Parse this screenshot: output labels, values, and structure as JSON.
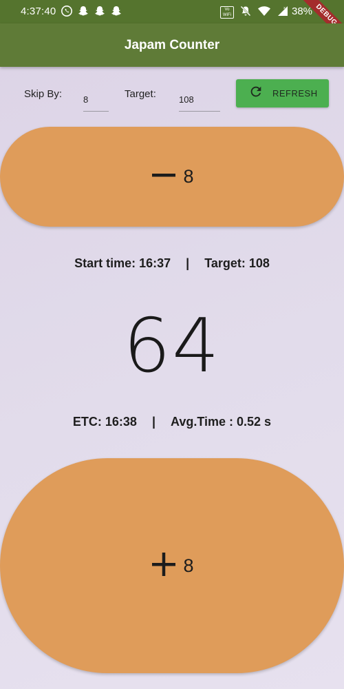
{
  "status_bar": {
    "time": "4:37:40",
    "left_icons": [
      "whatsapp-icon",
      "snapchat-icon",
      "snapchat-icon",
      "snapchat-icon"
    ],
    "vowifi_label_top": "Vo",
    "vowifi_label_bottom": "WiFi",
    "right_icons": [
      "vowifi-icon",
      "mute-icon",
      "wifi-icon",
      "cellular-signal-icon"
    ],
    "battery": "38%"
  },
  "debug_banner": "DEBUG",
  "app_bar": {
    "title": "Japam Counter"
  },
  "controls": {
    "skip_label": "Skip By:",
    "skip_value": "8",
    "target_label": "Target:",
    "target_value": "108",
    "refresh_label": "REFRESH"
  },
  "minus_button": {
    "icon": "minus-icon",
    "amount": "8"
  },
  "stats_top": {
    "start_time": "Start time: 16:37",
    "separator": "|",
    "target": "Target: 108"
  },
  "counter": {
    "value": "64"
  },
  "stats_bottom": {
    "etc": "ETC: 16:38",
    "separator": "|",
    "avg_time": "Avg.Time : 0.52 s"
  },
  "plus_button": {
    "icon": "plus-icon",
    "amount": "8"
  },
  "colors": {
    "status_bar": "#55742e",
    "app_bar": "#5f7b37",
    "refresh_button": "#4caf50",
    "pill_button": "#df9c5a",
    "debug_ribbon": "#a42c2c"
  }
}
